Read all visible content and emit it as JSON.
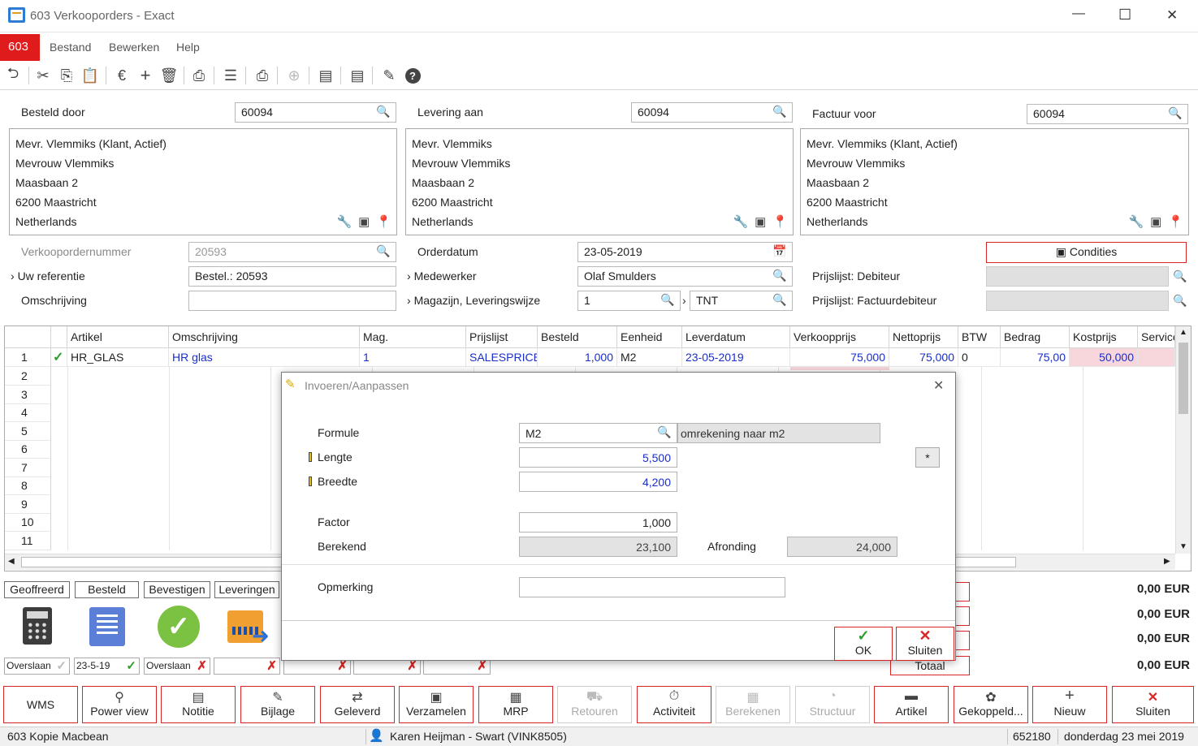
{
  "window": {
    "title": "603 Verkooporders - Exact",
    "minimize": "—",
    "maximize": "☐",
    "close": "✕"
  },
  "menu": {
    "company_badge": "603",
    "items": [
      "Bestand",
      "Bewerken",
      "Help"
    ]
  },
  "toolbar": {
    "icons": [
      "undo-icon",
      "cut-icon",
      "copy-icon",
      "paste-icon",
      "euro-icon",
      "add-icon",
      "delete-icon",
      "preview-icon",
      "list-icon",
      "print-icon",
      "zoom-icon",
      "note-icon",
      "note2-icon",
      "attachment-icon",
      "help-icon"
    ]
  },
  "addresses": {
    "ordered_by": {
      "label": "Besteld door",
      "code": "60094",
      "lines": [
        "Mevr. Vlemmiks (Klant, Actief)",
        "Mevrouw Vlemmiks",
        "Maasbaan 2",
        "6200  Maastricht",
        "Netherlands"
      ]
    },
    "delivery_to": {
      "label": "Levering aan",
      "code": "60094",
      "lines": [
        "Mevr. Vlemmiks",
        "Mevrouw Vlemmiks",
        "Maasbaan 2",
        "6200  Maastricht",
        "Netherlands"
      ]
    },
    "invoice_to": {
      "label": "Factuur voor",
      "code": "60094",
      "lines": [
        "Mevr. Vlemmiks (Klant, Actief)",
        "Mevrouw Vlemmiks",
        "Maasbaan 2",
        "6200  Maastricht",
        "Netherlands"
      ]
    }
  },
  "order": {
    "number_label": "Verkoopordernummer",
    "number": "20593",
    "reference_label": "Uw referentie",
    "reference": "Bestel.: 20593",
    "description_label": "Omschrijving",
    "description": "",
    "date_label": "Orderdatum",
    "date": "23-05-2019",
    "employee_label": "Medewerker",
    "employee": "Olaf Smulders",
    "warehouse_label": "Magazijn, Leveringswijze",
    "warehouse": "1",
    "delivery_method": "TNT",
    "conditions_button": "Condities",
    "pricelist_debtor_label": "Prijslijst: Debiteur",
    "pricelist_invoice_label": "Prijslijst: Factuurdebiteur"
  },
  "grid": {
    "columns": [
      "Artikel",
      "Omschrijving",
      "Mag.",
      "Prijslijst",
      "Besteld",
      "Eenheid",
      "Leverdatum",
      "Verkoopprijs",
      "Nettoprijs",
      "BTW",
      "Bedrag",
      "Kostprijs",
      "Service"
    ],
    "rows": [
      {
        "num": "1",
        "artikel": "HR_GLAS",
        "omschrijving": "HR glas",
        "mag": "1",
        "prijslijst": "SALESPRICE",
        "besteld": "1,000",
        "eenheid": "M2",
        "leverdatum": "23-05-2019",
        "verkoopprijs": "75,000",
        "nettoprijs": "75,000",
        "btw": "0",
        "bedrag": "75,00",
        "kostprijs": "50,000"
      }
    ],
    "row_numbers": [
      "1",
      "2",
      "3",
      "4",
      "5",
      "6",
      "7",
      "8",
      "9",
      "10",
      "11"
    ]
  },
  "status": {
    "buttons": [
      "Geoffreerd",
      "Besteld",
      "Bevestigen",
      "Leveringen"
    ],
    "fields": [
      {
        "text": "Overslaan",
        "mark": "✓"
      },
      {
        "text": "23-5-19",
        "mark": "✓"
      },
      {
        "text": "Overslaan",
        "mark": "✗"
      },
      {
        "text": "",
        "mark": "✗"
      },
      {
        "text": "",
        "mark": "✗"
      },
      {
        "text": "",
        "mark": "✗"
      },
      {
        "text": "",
        "mark": "✗"
      }
    ],
    "totals": [
      "0,00 EUR",
      "0,00 EUR",
      "0,00 EUR",
      "0,00 EUR"
    ],
    "total_label": "Totaal"
  },
  "bottom_buttons": [
    {
      "label": "WMS",
      "icon": "",
      "enabled": true
    },
    {
      "label": "Power view",
      "icon": "⚲",
      "enabled": true
    },
    {
      "label": "Notitie",
      "icon": "▤",
      "enabled": true
    },
    {
      "label": "Bijlage",
      "icon": "✎",
      "enabled": true
    },
    {
      "label": "Geleverd",
      "icon": "⇄",
      "enabled": true
    },
    {
      "label": "Verzamelen",
      "icon": "▣",
      "enabled": true
    },
    {
      "label": "MRP",
      "icon": "▦",
      "enabled": true
    },
    {
      "label": "Retouren",
      "icon": "⛟",
      "enabled": false
    },
    {
      "label": "Activiteit",
      "icon": "⏱",
      "enabled": true
    },
    {
      "label": "Berekenen",
      "icon": "▦",
      "enabled": false
    },
    {
      "label": "Structuur",
      "icon": "◔",
      "enabled": false
    },
    {
      "label": "Artikel",
      "icon": "▬",
      "enabled": true
    },
    {
      "label": "Gekoppeld...",
      "icon": "✿",
      "enabled": true
    },
    {
      "label": "Nieuw",
      "icon": "+",
      "enabled": true
    },
    {
      "label": "Sluiten",
      "icon": "✕",
      "enabled": true
    }
  ],
  "statusbar": {
    "company": "603 Kopie Macbean",
    "user": "Karen Heijman - Swart (VINK8505)",
    "number": "652180",
    "date": "donderdag 23 mei 2019"
  },
  "dialog": {
    "title": "Invoeren/Aanpassen",
    "formule_label": "Formule",
    "formule": "M2",
    "formule_desc": "omrekening naar m2",
    "lengte_label": "Lengte",
    "lengte": "5,500",
    "breedte_label": "Breedte",
    "breedte": "4,200",
    "star_button": "*",
    "factor_label": "Factor",
    "factor": "1,000",
    "berekend_label": "Berekend",
    "berekend": "23,100",
    "afronding_label": "Afronding",
    "afronding": "24,000",
    "opmerking_label": "Opmerking",
    "opmerking": "",
    "ok_label": "OK",
    "close_label": "Sluiten"
  },
  "colors": {
    "accent_red": "#d82626",
    "link_blue": "#1a2ec8",
    "check_green": "#2a9d2a"
  }
}
